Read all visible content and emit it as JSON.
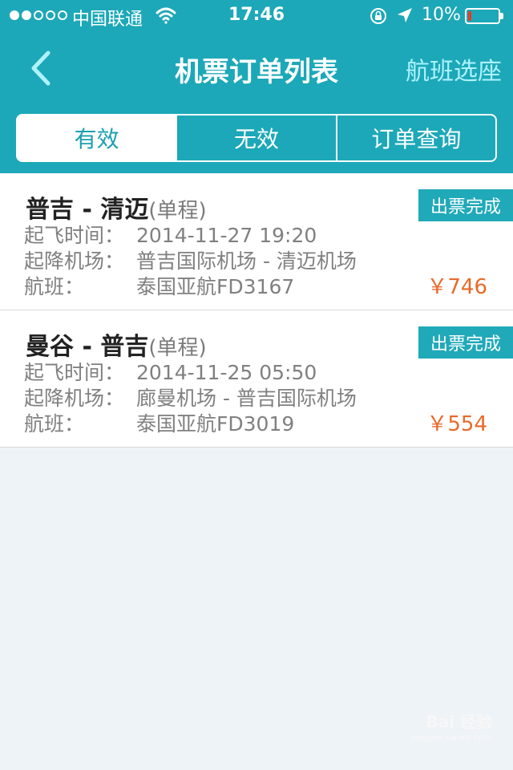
{
  "status_bar": {
    "carrier": "中国联通",
    "time": "17:46",
    "battery_percent_text": "10%",
    "battery_level": 0.1,
    "signal_bars_filled": 2,
    "signal_bars_total": 5
  },
  "nav": {
    "title": "机票订单列表",
    "right_action": "航班选座"
  },
  "tabs": [
    {
      "label": "有效",
      "active": true
    },
    {
      "label": "无效",
      "active": false
    },
    {
      "label": "订单查询",
      "active": false
    }
  ],
  "orders": [
    {
      "route": "普吉 - 清迈",
      "trip_type": "(单程)",
      "status": "出票完成",
      "departure_label": "起飞时间：",
      "departure_value": "2014-11-27 19:20",
      "airports_label": "起降机场：",
      "airports_value": "普吉国际机场 - 清迈机场",
      "flight_label": "航班：",
      "flight_value": "泰国亚航FD3167",
      "price": "￥746"
    },
    {
      "route": "曼谷 - 普吉",
      "trip_type": "(单程)",
      "status": "出票完成",
      "departure_label": "起飞时间：",
      "departure_value": "2014-11-25 05:50",
      "airports_label": "起降机场：",
      "airports_value": "廊曼机场 - 普吉国际机场",
      "flight_label": "航班：",
      "flight_value": "泰国亚航FD3019",
      "price": "￥554"
    }
  ],
  "colors": {
    "brand": "#1ca8b8",
    "price": "#e86a2a",
    "background": "#eef3f8",
    "right_action": "#aef2ff",
    "battery_low": "#e8392b"
  },
  "watermark": {
    "main": "Bai 经验",
    "sub": "jingyan.baidu.com"
  },
  "icons": {
    "back": "chevron-left-icon",
    "wifi": "wifi-icon",
    "lock": "rotation-lock-icon",
    "location": "location-arrow-icon",
    "battery": "battery-icon"
  }
}
